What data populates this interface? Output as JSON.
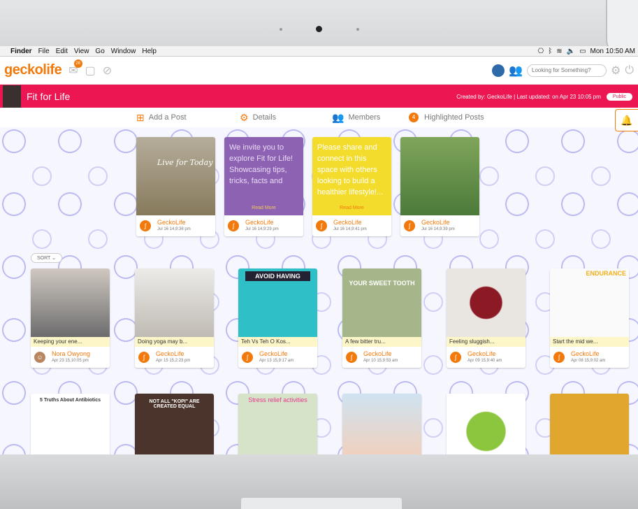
{
  "macbar": {
    "apple": "",
    "menus": [
      "Finder",
      "File",
      "Edit",
      "View",
      "Go",
      "Window",
      "Help"
    ],
    "time": "Mon 10:50 AM"
  },
  "nav": {
    "logo": "geckolife",
    "msg_badge": "28",
    "search_placeholder": "Looking for Something?"
  },
  "group": {
    "title": "Fit for Life",
    "created": "Created by: GeckoLife | Last updated: on Apr 23 10:05 pm",
    "visibility": "Public"
  },
  "tabs": {
    "add": "Add a Post",
    "details": "Details",
    "members": "Members",
    "highlighted_count": "4",
    "highlighted": "Highlighted Posts"
  },
  "sort": "SORT",
  "highlighted_posts": [
    {
      "author": "GeckoLife",
      "date": "Jul 16 14,9:36 pm",
      "image_text": "Live for Today"
    },
    {
      "author": "GeckoLife",
      "date": "Jul 16 14,9:29 pm",
      "text": "We invite you to explore Fit for Life! Showcasing tips, tricks, facts and",
      "readmore": "Read More"
    },
    {
      "author": "GeckoLife",
      "date": "Jul 16 14,9:41 pm",
      "text": "Please share and connect in this space with others looking to build a healthier lifestyle!...",
      "readmore": "Read More"
    },
    {
      "author": "GeckoLife",
      "date": "Jul 16 14,9:39 pm"
    }
  ],
  "posts": [
    {
      "caption": "Keeping your ene...",
      "author": "Nora Owyong",
      "date": "Apr 23 15,10:05 pm"
    },
    {
      "caption": "Doing yoga may b...",
      "author": "GeckoLife",
      "date": "Apr 15 15,2:23 pm"
    },
    {
      "caption": "Teh Vs Teh O Kos...",
      "author": "GeckoLife",
      "date": "Apr 13 15,9:17 am",
      "image_title": "AVOID HAVING"
    },
    {
      "caption": "A few bitter tru...",
      "author": "GeckoLife",
      "date": "Apr 10 15,9:53 am",
      "image_title": "YOUR SWEET TOOTH"
    },
    {
      "caption": "Feeling sluggish...",
      "author": "GeckoLife",
      "date": "Apr 09 15,9:40 am"
    },
    {
      "caption": "Start the mid we...",
      "author": "GeckoLife",
      "date": "Apr 08 15,9:02 am",
      "image_title": "ENDURANCE"
    }
  ],
  "bottom_posts": [
    {
      "image_title": "5 Truths About Antibiotics"
    },
    {
      "image_title": "NOT ALL \"KOPI\" ARE CREATED EQUAL"
    },
    {
      "image_title": "Stress relief activities"
    },
    {
      "image_title": ""
    },
    {
      "image_title": ""
    },
    {
      "image_title": ""
    }
  ],
  "colors": {
    "accent": "#f27a0d",
    "group_bar": "#ec1652"
  }
}
